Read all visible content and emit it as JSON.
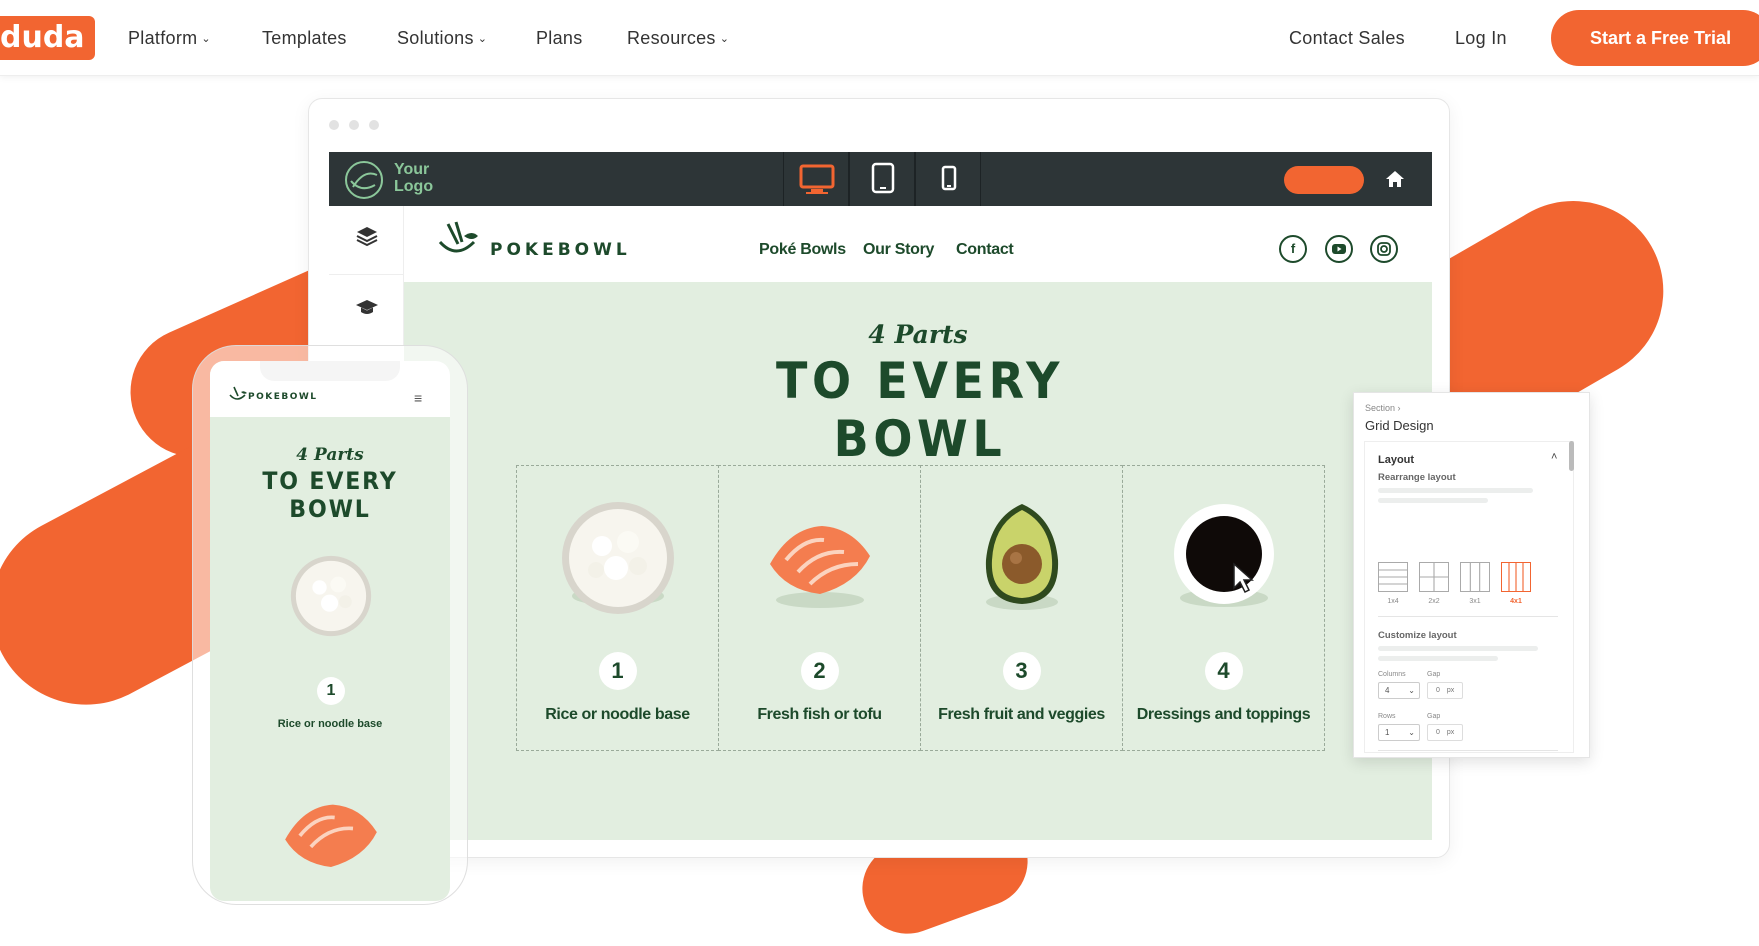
{
  "nav": {
    "logo": "duda",
    "items": [
      {
        "label": "Platform",
        "has_dropdown": true
      },
      {
        "label": "Templates",
        "has_dropdown": false
      },
      {
        "label": "Solutions",
        "has_dropdown": true
      },
      {
        "label": "Plans",
        "has_dropdown": false
      },
      {
        "label": "Resources",
        "has_dropdown": true
      }
    ],
    "contact_sales": "Contact Sales",
    "login": "Log In",
    "cta": "Start a Free Trial"
  },
  "editor": {
    "logo_text_line1": "Your",
    "logo_text_line2": "Logo",
    "devices": [
      "desktop-icon",
      "tablet-icon",
      "mobile-icon"
    ],
    "active_device": "desktop",
    "accent": "#f26531"
  },
  "site": {
    "brand": "POKEBOWL",
    "nav": [
      "Poké Bowls",
      "Our Story",
      "Contact"
    ],
    "social": [
      "facebook-icon",
      "youtube-icon",
      "instagram-icon"
    ],
    "script": "4 Parts",
    "headline": "TO EVERY BOWL",
    "items": [
      {
        "number": "1",
        "caption": "Rice or noodle base",
        "image": "rice-bowl"
      },
      {
        "number": "2",
        "caption": "Fresh fish or tofu",
        "image": "salmon"
      },
      {
        "number": "3",
        "caption": "Fresh fruit and veggies",
        "image": "avocado"
      },
      {
        "number": "4",
        "caption": "Dressings and toppings",
        "image": "soy-sauce"
      }
    ],
    "colors": {
      "green": "#1d4a2b",
      "background": "#e2eee0"
    }
  },
  "panel": {
    "breadcrumb": "Section",
    "title": "Grid Design",
    "layout_label": "Layout",
    "rearrange_label": "Rearrange layout",
    "layouts": [
      "1x4",
      "2x2",
      "3x1",
      "4x1"
    ],
    "selected_layout": "4x1",
    "customize_label": "Customize layout",
    "columns_label": "Columns",
    "columns_value": "4",
    "rows_label": "Rows",
    "rows_value": "1",
    "gap_label": "Gap",
    "gap_value": "0",
    "gap_unit": "px"
  },
  "mobile": {
    "brand": "POKEBOWL",
    "script": "4 Parts",
    "headline": "TO EVERY BOWL",
    "item_number": "1",
    "item_caption": "Rice or noodle base"
  }
}
